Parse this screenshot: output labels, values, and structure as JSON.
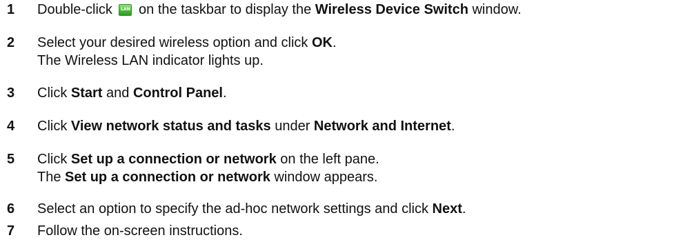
{
  "steps": [
    {
      "number": "1",
      "lines": [
        {
          "parts": [
            "Double-click ",
            "",
            " on the taskbar to display the ",
            "Wireless Device Switch",
            " window."
          ]
        }
      ],
      "icon_name": "lan-taskbar-icon",
      "icon_text": "LAN"
    },
    {
      "number": "2",
      "lines": [
        {
          "parts": [
            "Select your desired wireless option and click ",
            "OK",
            "."
          ]
        },
        {
          "parts": [
            "The Wireless LAN indicator lights up."
          ]
        }
      ]
    },
    {
      "number": "3",
      "lines": [
        {
          "parts": [
            "Click ",
            "Start",
            " and ",
            "Control Panel",
            "."
          ]
        }
      ]
    },
    {
      "number": "4",
      "lines": [
        {
          "parts": [
            "Click ",
            "View network status and tasks",
            " under ",
            "Network and Internet",
            "."
          ]
        }
      ]
    },
    {
      "number": "5",
      "lines": [
        {
          "parts": [
            "Click ",
            "Set up a connection or network",
            " on the left pane."
          ]
        },
        {
          "parts": [
            "The ",
            "Set up a connection or network",
            " window appears."
          ]
        }
      ]
    },
    {
      "number": "6",
      "lines": [
        {
          "parts": [
            "Select an option to specify the ad-hoc network settings and click ",
            "Next",
            "."
          ]
        }
      ]
    },
    {
      "number": "7",
      "lines": [
        {
          "parts": [
            "Follow the on-screen instructions."
          ]
        }
      ]
    }
  ],
  "colors": {
    "text": "#111111",
    "icon_green": "#4fbf3c"
  }
}
